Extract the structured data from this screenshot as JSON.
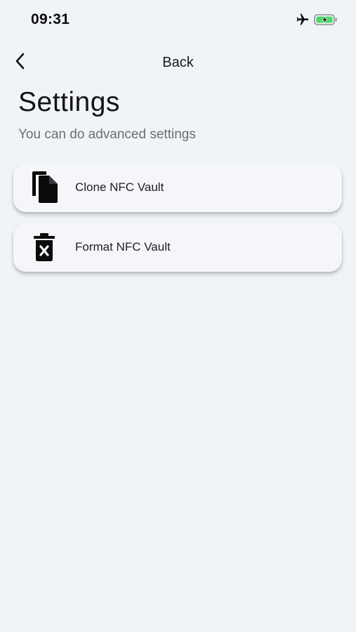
{
  "status_bar": {
    "time": "09:31",
    "icons": [
      "airplane-icon",
      "battery-charging-icon"
    ],
    "battery_color": "#4cd964"
  },
  "nav": {
    "back_label": "Back",
    "back_icon": "chevron-left-icon"
  },
  "page": {
    "title": "Settings",
    "subtitle": "You can do advanced settings"
  },
  "menu": {
    "items": [
      {
        "label": "Clone NFC Vault",
        "icon": "copy-files-icon"
      },
      {
        "label": "Format NFC Vault",
        "icon": "delete-bin-icon"
      }
    ]
  },
  "colors": {
    "background": "#f0f3f7",
    "card": "#f4f6f9",
    "subtitle": "#6b6f75"
  }
}
